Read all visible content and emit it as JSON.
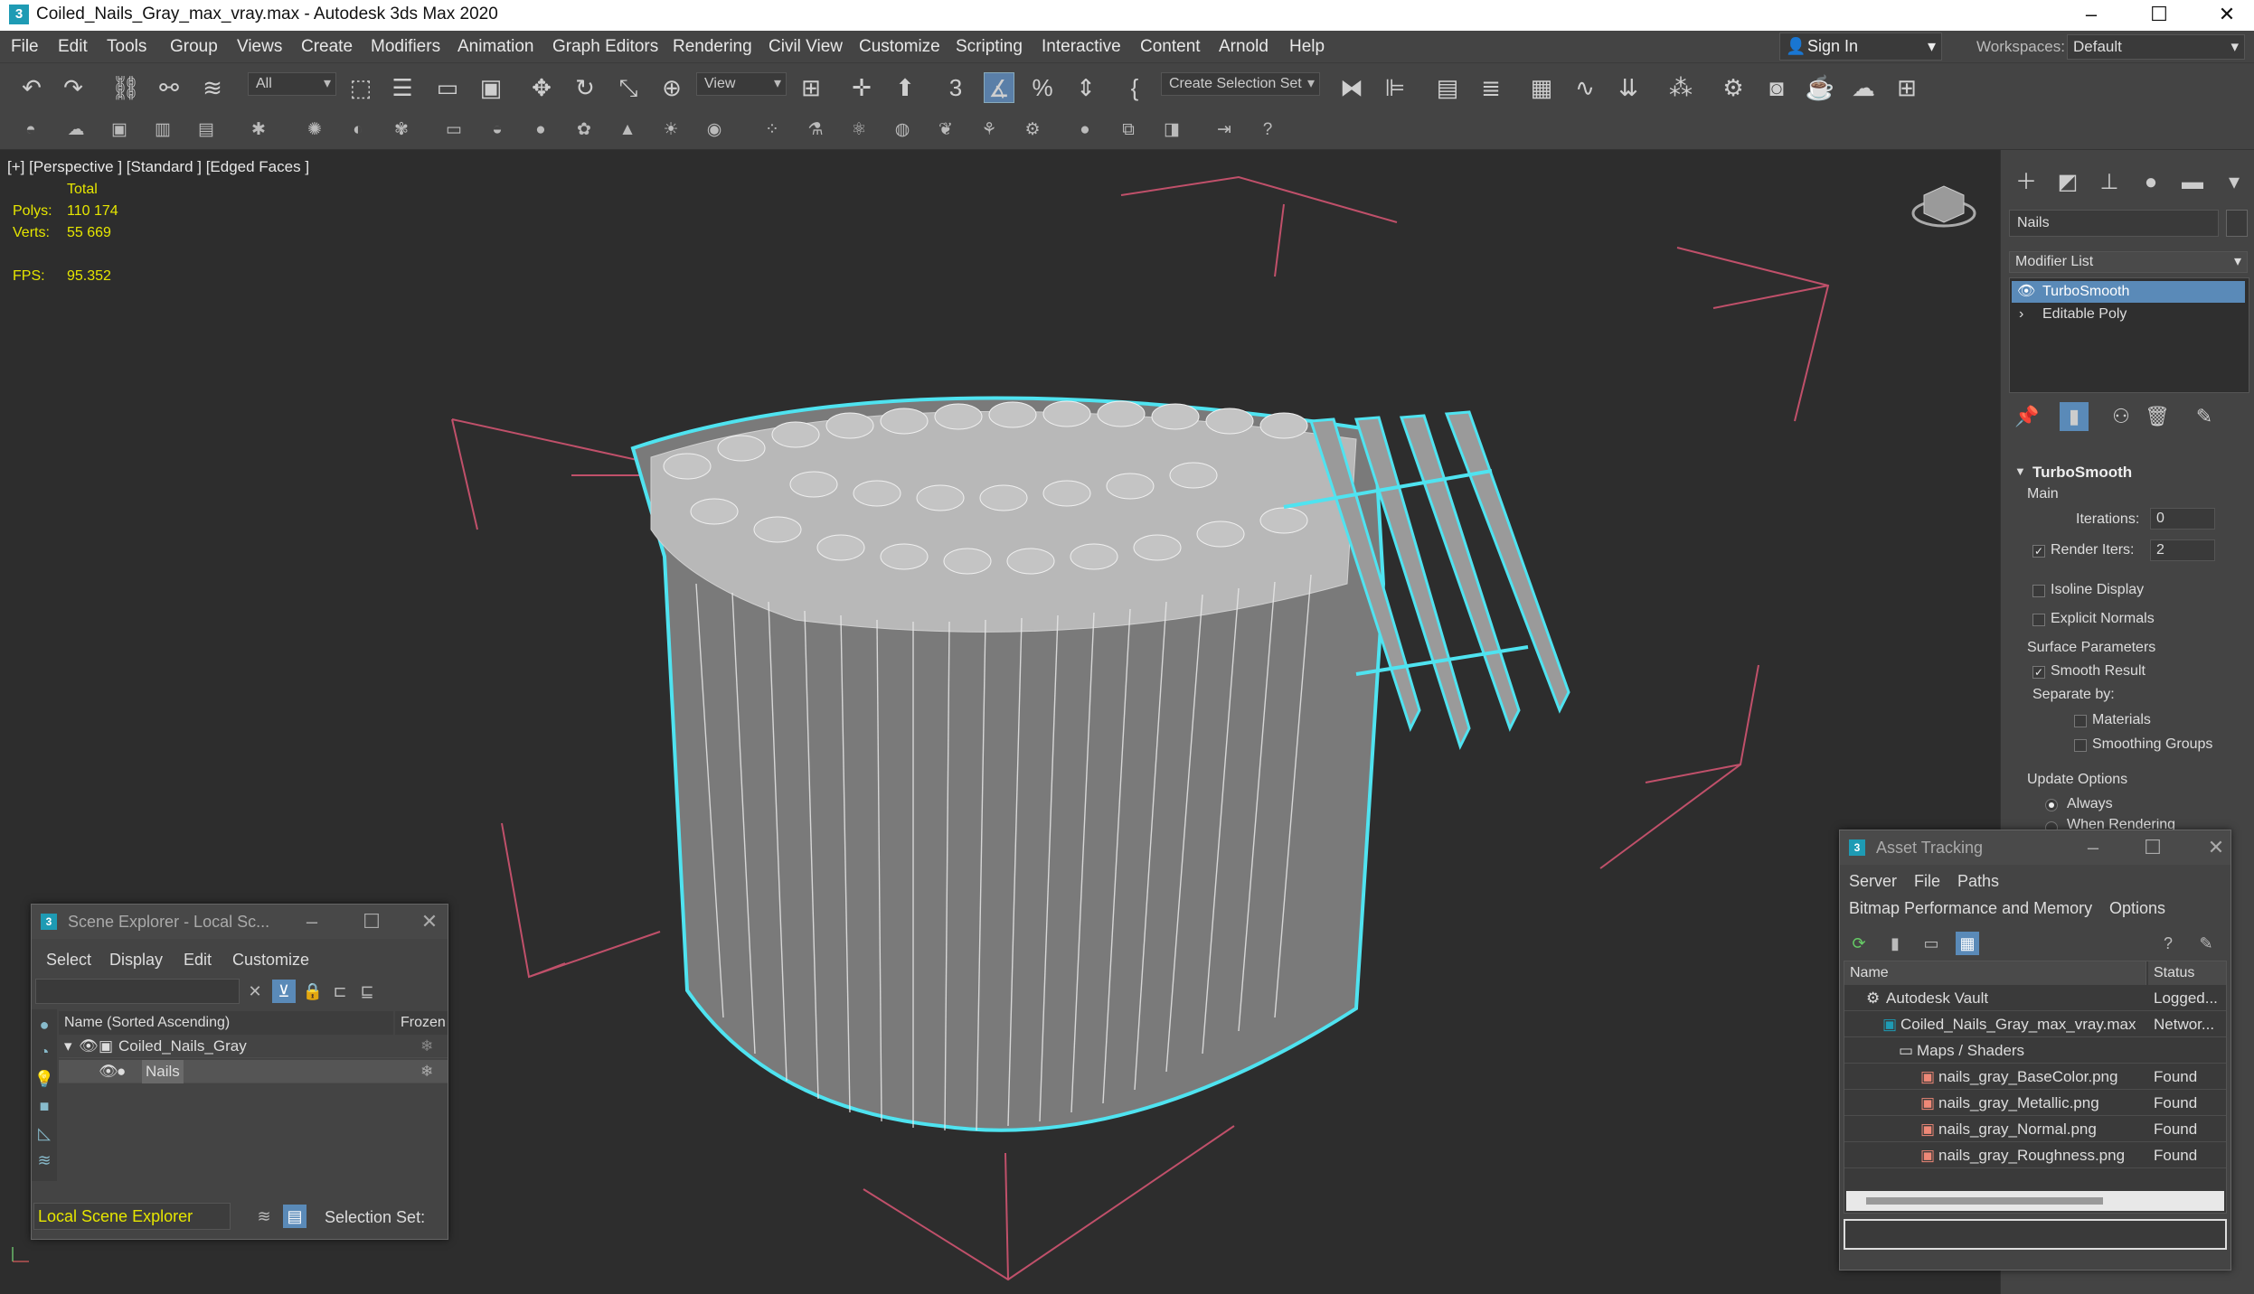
{
  "titlebar": {
    "title": "Coiled_Nails_Gray_max_vray.max - Autodesk 3ds Max 2020",
    "app_icon": "3"
  },
  "menu": [
    "File",
    "Edit",
    "Tools",
    "Group",
    "Views",
    "Create",
    "Modifiers",
    "Animation",
    "Graph Editors",
    "Rendering",
    "Civil View",
    "Customize",
    "Scripting",
    "Interactive",
    "Content",
    "Arnold",
    "Help"
  ],
  "signin": "Sign In",
  "workspaces": {
    "label": "Workspaces:",
    "value": "Default"
  },
  "toolbar": {
    "filter_dropdown": "All",
    "ref_coord_dropdown": "View",
    "selection_set": "Create Selection Set"
  },
  "viewport": {
    "label": "[+] [Perspective ] [Standard ] [Edged Faces ]",
    "stats_header": "Total",
    "polys_label": "Polys:",
    "polys_value": "110 174",
    "verts_label": "Verts:",
    "verts_value": "55 669",
    "fps_label": "FPS:",
    "fps_value": "95.352"
  },
  "command_panel": {
    "object_name": "Nails",
    "modifier_list": "Modifier List",
    "stack": [
      {
        "label": "TurboSmooth",
        "selected": true
      },
      {
        "label": "Editable Poly",
        "selected": false
      }
    ],
    "rollout": {
      "title": "TurboSmooth",
      "main": "Main",
      "iterations_label": "Iterations:",
      "iterations_value": "0",
      "render_iters_label": "Render Iters:",
      "render_iters_value": "2",
      "isoline": "Isoline Display",
      "explicit_normals": "Explicit Normals",
      "surface_params": "Surface Parameters",
      "smooth_result": "Smooth Result",
      "separate_by": "Separate by:",
      "materials": "Materials",
      "smoothing_groups": "Smoothing Groups",
      "update_options": "Update Options",
      "always": "Always",
      "when_rendering": "When Rendering"
    }
  },
  "scene_explorer": {
    "title": "Scene Explorer - Local Sc...",
    "menu": [
      "Select",
      "Display",
      "Edit",
      "Customize"
    ],
    "col_name": "Name (Sorted Ascending)",
    "col_frozen": "Frozen",
    "rows": [
      {
        "label": "Coiled_Nails_Gray"
      },
      {
        "label": "Nails"
      }
    ],
    "footer_dropdown": "Local Scene Explorer",
    "selection_set_label": "Selection Set:"
  },
  "asset_tracking": {
    "title": "Asset Tracking",
    "menu1": [
      "Server",
      "File",
      "Paths"
    ],
    "menu2": [
      "Bitmap Performance and Memory",
      "Options"
    ],
    "col_name": "Name",
    "col_status": "Status",
    "rows": [
      {
        "name": "Autodesk Vault",
        "status": "Logged..."
      },
      {
        "name": "Coiled_Nails_Gray_max_vray.max",
        "status": "Networ..."
      },
      {
        "name": "Maps / Shaders",
        "status": ""
      },
      {
        "name": "nails_gray_BaseColor.png",
        "status": "Found"
      },
      {
        "name": "nails_gray_Metallic.png",
        "status": "Found"
      },
      {
        "name": "nails_gray_Normal.png",
        "status": "Found"
      },
      {
        "name": "nails_gray_Roughness.png",
        "status": "Found"
      }
    ]
  },
  "colors": {
    "accent": "#5a8ab8",
    "stat_yellow": "#e6e600",
    "wire_cyan": "#4fe3f0",
    "bbox_pink": "#c0506a"
  }
}
